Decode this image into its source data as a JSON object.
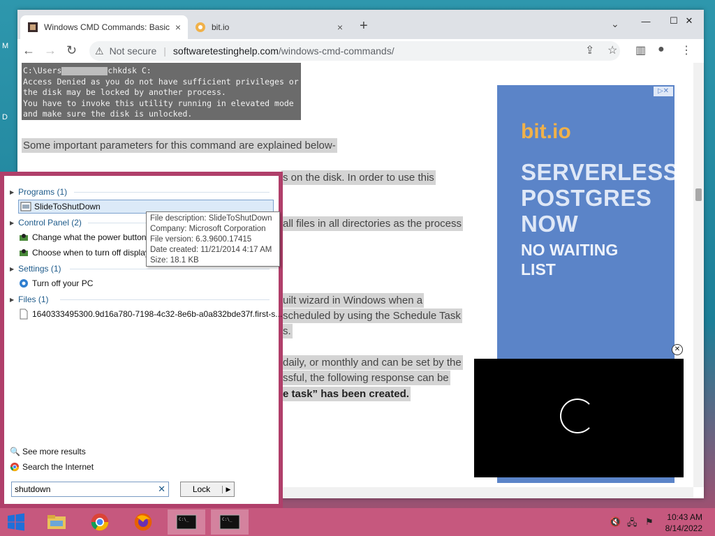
{
  "browser": {
    "tabs": [
      {
        "title": "Windows CMD Commands: Basic",
        "close": "×"
      },
      {
        "title": "bit.io",
        "close": "×"
      }
    ],
    "new_tab": "+",
    "address": {
      "security": "Not secure",
      "host": "softwaretestinghelp.com",
      "path": "/windows-cmd-commands/"
    }
  },
  "page": {
    "code_lines": [
      "C:\\Users",
      "chkdsk C:",
      "Access Denied as you do not have sufficient privileges or",
      "the disk may be locked by another process.",
      "You have to invoke this utility running in elevated mode",
      "and make sure the disk is unlocked."
    ],
    "paragraph_1": "Some important parameters for this command are explained below-",
    "frag_1": "s on the disk. In order to use this",
    "frag_2": "all files in all directories as the process",
    "frag_3": "uilt wizard in Windows when a",
    "frag_4": "scheduled by using the Schedule Task",
    "frag_5": "s.",
    "frag_6": "daily, or monthly and can be set by the",
    "frag_7": "ssful, the following response can be",
    "frag_8": "e task” has been created."
  },
  "ad": {
    "brand": "bit.io",
    "headline_lines": [
      "SERVERLESS",
      "POSTGRES",
      "NOW"
    ],
    "sub_lines": [
      "NO WAITING",
      "LIST"
    ],
    "ad_marker": "▷✕"
  },
  "start_menu": {
    "categories": [
      {
        "label": "Programs (1)"
      },
      {
        "label": "Control Panel (2)"
      },
      {
        "label": "Settings (1)"
      },
      {
        "label": "Files (1)"
      }
    ],
    "items": {
      "programs": [
        "SlideToShutDown"
      ],
      "control_panel": [
        "Change what the power buttons do",
        "Choose when to turn off display"
      ],
      "settings": [
        "Turn off your PC"
      ],
      "files": [
        "1640333495300.9d16a780-7198-4c32-8e6b-a0a832bde37f.first-s..."
      ]
    },
    "see_more": "See more results",
    "search_internet": "Search the Internet",
    "search_value": "shutdown",
    "lock_label": "Lock"
  },
  "tooltip": {
    "lines": [
      "File description: SlideToShutDown",
      "Company: Microsoft Corporation",
      "File version: 6.3.9600.17415",
      "Date created: 11/21/2014 4:17 AM",
      "Size: 18.1 KB"
    ]
  },
  "taskbar": {
    "time": "10:43 AM",
    "date": "8/14/2022"
  },
  "colors": {
    "accent_start": "#b03f6a",
    "taskbar": "#c6587e",
    "ad_bg": "#5b84c8",
    "ad_brand": "#f0b14a"
  }
}
